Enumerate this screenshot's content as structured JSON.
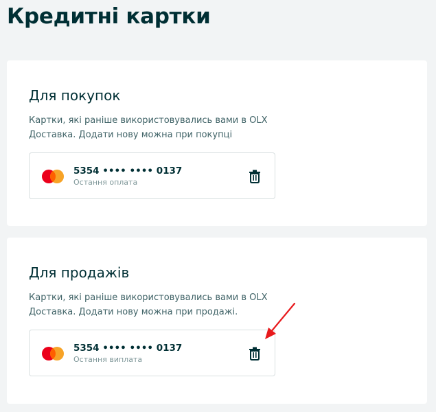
{
  "page": {
    "title": "Кредитні картки"
  },
  "purchases": {
    "title": "Для покупок",
    "description": "Картки, які раніше використовувались вами в OLX Доставка. Додати нову можна при покупці",
    "card": {
      "brand_icon": "mastercard-icon",
      "number": "5354 •••• •••• 0137",
      "subtitle": "Остання оплата",
      "delete_icon": "trash-icon"
    }
  },
  "sales": {
    "title": "Для продажів",
    "description": "Картки, які раніше використовувались вами в OLX Доставка. Додати нову можна при продажі.",
    "card": {
      "brand_icon": "mastercard-icon",
      "number": "5354 •••• •••• 0137",
      "subtitle": "Остання виплата",
      "delete_icon": "trash-icon"
    }
  },
  "colors": {
    "text_primary": "#002f34",
    "text_secondary": "#406367",
    "mastercard_red": "#eb001b",
    "mastercard_orange": "#f79e1b",
    "annotation_arrow": "#e8191c"
  }
}
